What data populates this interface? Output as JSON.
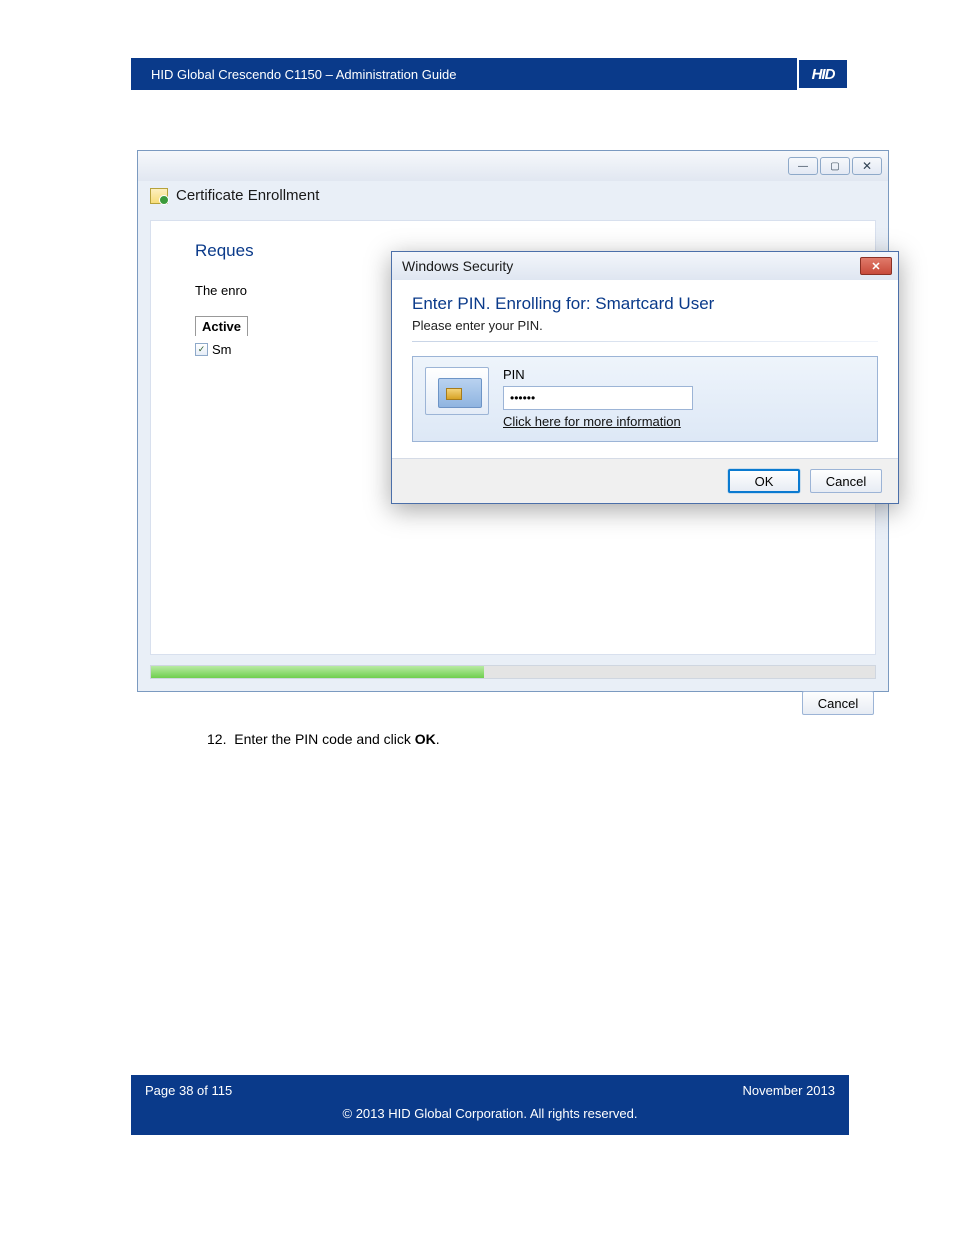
{
  "doc_header": "HID Global Crescendo C1150  – Administration Guide",
  "logo_text": "HID",
  "outer_window": {
    "title": "Certificate Enrollment",
    "blue_heading": "Reques",
    "enrol_line": "The enro",
    "active_label": "Active",
    "sm_label": "Sm",
    "cancel_label": "Cancel",
    "progress_percent": 46
  },
  "security_dialog": {
    "title": "Windows Security",
    "heading": "Enter PIN. Enrolling for: Smartcard User",
    "subtext": "Please enter your PIN.",
    "pin_label": "PIN",
    "pin_value": "••••••",
    "info_link": "Click here for more information",
    "ok_label": "OK",
    "cancel_label": "Cancel"
  },
  "step": {
    "number": "12.",
    "prefix": "Enter the PIN code and click ",
    "bold": "OK",
    "suffix": "."
  },
  "footer": {
    "page": "Page 38 of 115",
    "date": "November 2013",
    "copyright": "© 2013 HID Global Corporation. All rights reserved."
  }
}
